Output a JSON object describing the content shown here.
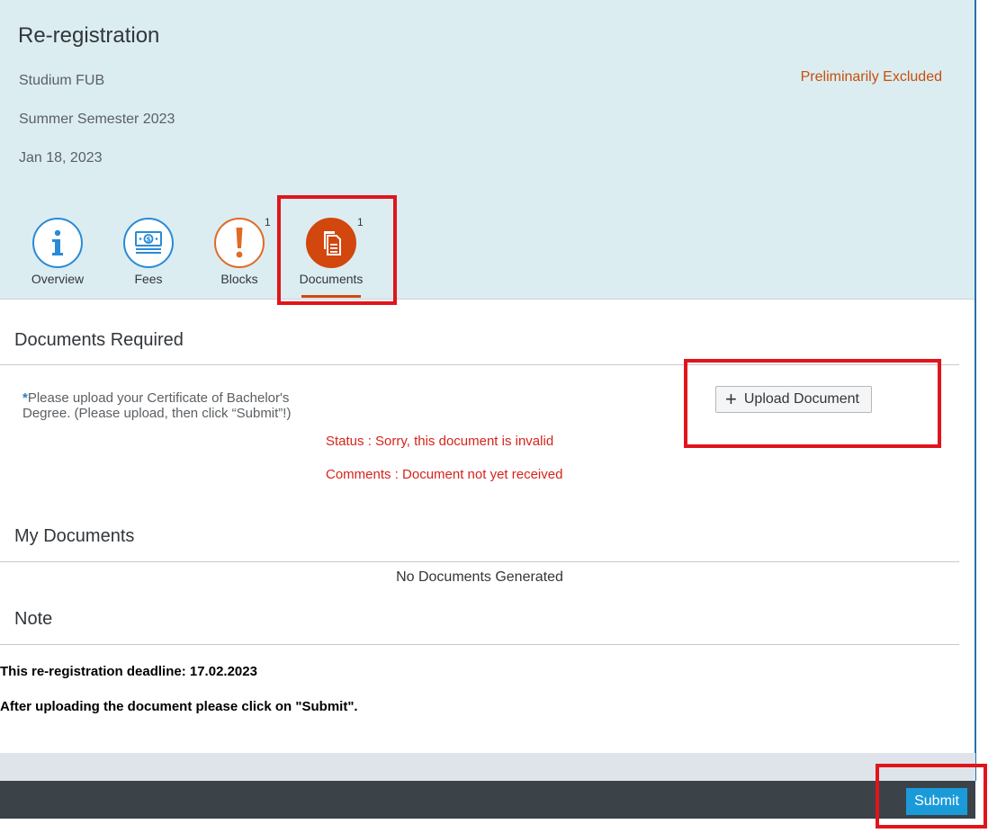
{
  "header": {
    "title": "Re-registration",
    "program": "Studium FUB",
    "semester": "Summer Semester 2023",
    "date": "Jan 18, 2023",
    "status": "Preliminarily Excluded"
  },
  "tabs": [
    {
      "label": "Overview",
      "icon": "info-icon",
      "count": ""
    },
    {
      "label": "Fees",
      "icon": "money-icon",
      "count": ""
    },
    {
      "label": "Blocks",
      "icon": "exclamation-icon",
      "count": "1"
    },
    {
      "label": "Documents",
      "icon": "documents-icon",
      "count": "1",
      "active": true
    }
  ],
  "documents_required": {
    "title": "Documents Required",
    "required_marker": "*",
    "item_text": "Please upload your Certificate of Bachelor's Degree. (Please upload, then click “Submit”!)",
    "status_line": "Status : Sorry, this document is invalid",
    "comments_line": "Comments : Document not yet received",
    "upload_label": "Upload Document"
  },
  "my_documents": {
    "title": "My Documents",
    "empty_message": "No Documents Generated"
  },
  "note": {
    "title": "Note",
    "lines": [
      "This re-registration deadline: 17.02.2023",
      "After uploading the document please click on \"Submit\"."
    ]
  },
  "footer": {
    "submit_label": "Submit"
  },
  "colors": {
    "header_bg": "#dbedf1",
    "accent_blue": "#2a8ad6",
    "alert_orange": "#d2470d",
    "error_red": "#d6241b",
    "highlight_box": "#e0151c",
    "footer_bg": "#3b4248",
    "submit_bg": "#1a9ad9"
  }
}
